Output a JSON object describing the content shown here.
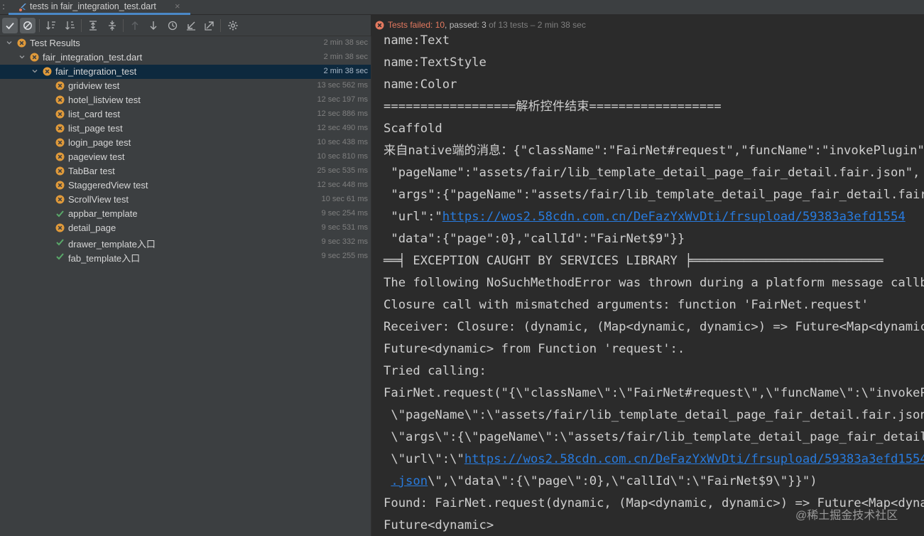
{
  "tab": {
    "title": "tests in fair_integration_test.dart",
    "close": "×"
  },
  "toolbar": {
    "buttons": [
      {
        "name": "show-passed",
        "icon": "check-icon"
      },
      {
        "name": "show-ignored",
        "icon": "circle-slash-icon"
      },
      {
        "name": "sort-alphabetically",
        "icon": "sort-alpha-icon"
      },
      {
        "name": "sort-by-duration",
        "icon": "sort-duration-icon"
      },
      {
        "name": "expand-all",
        "icon": "expand-all-icon"
      },
      {
        "name": "collapse-all",
        "icon": "collapse-all-icon"
      },
      {
        "name": "previous-failed",
        "icon": "arrow-up-icon"
      },
      {
        "name": "next-failed",
        "icon": "arrow-down-icon"
      },
      {
        "name": "test-history",
        "icon": "history-icon"
      },
      {
        "name": "import-tests",
        "icon": "import-icon"
      },
      {
        "name": "export-tests",
        "icon": "export-icon"
      },
      {
        "name": "settings",
        "icon": "gear-icon"
      }
    ]
  },
  "status": {
    "failed": "Tests failed: 10",
    "sep": ", ",
    "passed": "passed: 3",
    "total": " of 13 tests – 2 min 38 sec"
  },
  "tree": {
    "root": {
      "label": "Test Results",
      "duration": "2 min 38 sec",
      "status": "failed"
    },
    "file": {
      "label": "fair_integration_test.dart",
      "duration": "2 min 38 sec",
      "status": "failed"
    },
    "group": {
      "label": "fair_integration_test",
      "duration": "2 min 38 sec",
      "status": "failed"
    },
    "tests": [
      {
        "label": "gridview test",
        "duration": "13 sec 562 ms",
        "status": "failed"
      },
      {
        "label": "hotel_listview test",
        "duration": "12 sec 197 ms",
        "status": "failed"
      },
      {
        "label": "list_card test",
        "duration": "12 sec 886 ms",
        "status": "failed"
      },
      {
        "label": "list_page test",
        "duration": "12 sec 490 ms",
        "status": "failed"
      },
      {
        "label": "login_page test",
        "duration": "10 sec 438 ms",
        "status": "failed"
      },
      {
        "label": "pageview test",
        "duration": "10 sec 810 ms",
        "status": "failed"
      },
      {
        "label": "TabBar test",
        "duration": "25 sec 535 ms",
        "status": "failed"
      },
      {
        "label": "StaggeredView test",
        "duration": "12 sec 448 ms",
        "status": "failed"
      },
      {
        "label": "ScrollView test",
        "duration": "10 sec 61 ms",
        "status": "failed"
      },
      {
        "label": "appbar_template",
        "duration": "9 sec 254 ms",
        "status": "passed"
      },
      {
        "label": "detail_page",
        "duration": "9 sec 531 ms",
        "status": "failed"
      },
      {
        "label": "drawer_template入口",
        "duration": "9 sec 332 ms",
        "status": "passed"
      },
      {
        "label": "fab_template入口",
        "duration": "9 sec 255 ms",
        "status": "passed"
      }
    ]
  },
  "console": {
    "lines": [
      {
        "text": "name:Text"
      },
      {
        "text": "name:TextStyle"
      },
      {
        "text": "name:Color"
      },
      {
        "text": "==================解析控件结束=================="
      },
      {
        "text": "Scaffold"
      },
      {
        "text": "来自native端的消息：{\"className\":\"FairNet#request\",\"funcName\":\"invokePlugin\","
      },
      {
        "text": " \"pageName\":\"assets/fair/lib_template_detail_page_fair_detail.fair.json\","
      },
      {
        "text": " \"args\":{\"pageName\":\"assets/fair/lib_template_detail_page_fair_detail.fair.json\","
      },
      {
        "pre": " \"url\":\"",
        "link": "https://wos2.58cdn.com.cn/DeFazYxWvDti/frsupload/59383a3efd1554",
        "post": ""
      },
      {
        "text": " \"data\":{\"page\":0},\"callId\":\"FairNet$9\"}}"
      },
      {
        "text": "══╡ EXCEPTION CAUGHT BY SERVICES LIBRARY ╞══════════════════════════"
      },
      {
        "text": "The following NoSuchMethodError was thrown during a platform message callback:"
      },
      {
        "text": "Closure call with mismatched arguments: function 'FairNet.request'"
      },
      {
        "text": "Receiver: Closure: (dynamic, (Map<dynamic, dynamic>) => Future<Map<dynamic, dynamic>>"
      },
      {
        "text": "Future<dynamic> from Function 'request':."
      },
      {
        "text": "Tried calling:"
      },
      {
        "text": "FairNet.request(\"{\\\"className\\\":\\\"FairNet#request\\\",\\\"funcName\\\":\\\"invokePlugin\\\","
      },
      {
        "text": " \\\"pageName\\\":\\\"assets/fair/lib_template_detail_page_fair_detail.fair.json\\\","
      },
      {
        "text": " \\\"args\\\":{\\\"pageName\\\":\\\"assets/fair/lib_template_detail_page_fair_detail.fair.json\\\","
      },
      {
        "pre": " \\\"url\\\":\\\"",
        "link": "https://wos2.58cdn.com.cn/DeFazYxWvDti/frsupload/59383a3efd1554",
        "post": ""
      },
      {
        "pre": " ",
        "link": ".json",
        "post": "\\\",\\\"data\\\":{\\\"page\\\":0},\\\"callId\\\":\\\"FairNet$9\\\"}}\")"
      },
      {
        "text": "Found: FairNet.request(dynamic, (Map<dynamic, dynamic>) => Future<Map<dynamic, dynamic>>"
      },
      {
        "text": "Future<dynamic>"
      }
    ]
  },
  "watermark": "@稀土掘金技术社区",
  "colors": {
    "failed": "#e09a3a",
    "passed": "#59a869",
    "link": "#287bde",
    "selected_row": "#0d293e"
  }
}
